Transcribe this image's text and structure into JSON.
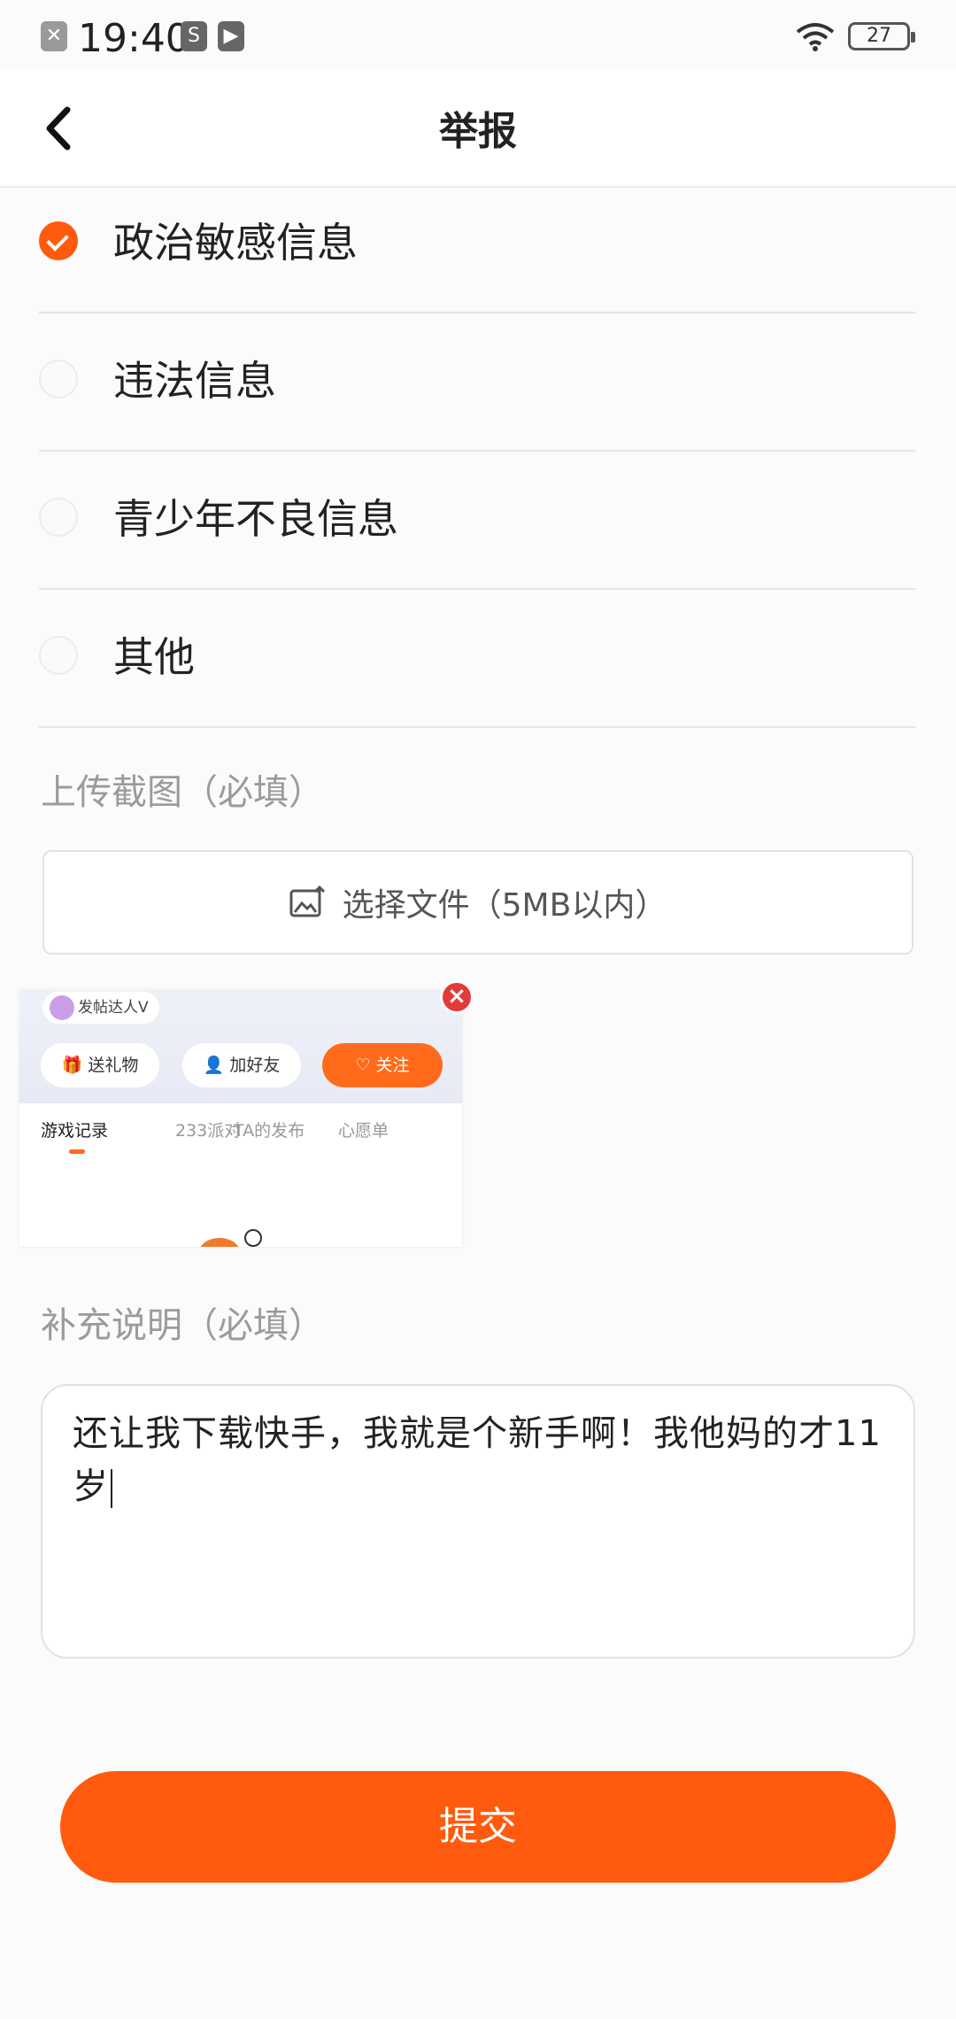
{
  "status_bar": {
    "time": "19:40",
    "battery": "27"
  },
  "header": {
    "title": "举报"
  },
  "options": [
    {
      "label": "政治敏感信息",
      "checked": true
    },
    {
      "label": "违法信息",
      "checked": false
    },
    {
      "label": "青少年不良信息",
      "checked": false
    },
    {
      "label": "其他",
      "checked": false
    }
  ],
  "upload": {
    "label": "上传截图（必填）",
    "button_label": "选择文件（5MB以内）"
  },
  "thumbnail": {
    "badge": "发帖达人V",
    "gift": "送礼物",
    "add_friend": "加好友",
    "follow": "关注",
    "tabs": [
      "游戏记录",
      "233派对",
      "TA的发布",
      "心愿单"
    ]
  },
  "description": {
    "label": "补充说明（必填）",
    "value": "还让我下载快手，我就是个新手啊！我他妈的才11岁"
  },
  "submit_label": "提交",
  "colors": {
    "accent": "#ff5a0d",
    "close": "#e23b3b"
  }
}
